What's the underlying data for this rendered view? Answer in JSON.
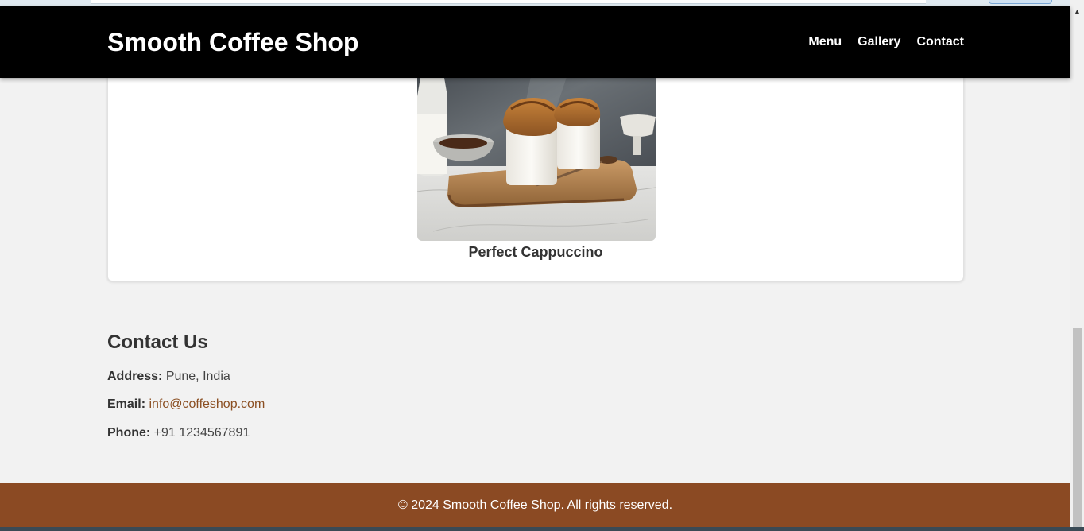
{
  "header": {
    "title": "Smooth Coffee Shop",
    "nav": [
      "Menu",
      "Gallery",
      "Contact"
    ]
  },
  "gallery": {
    "caption": "Perfect Cappuccino"
  },
  "contact": {
    "heading": "Contact Us",
    "address_label": "Address:",
    "address_value": "Pune, India",
    "email_label": "Email:",
    "email_value": "info@coffeshop.com",
    "phone_label": "Phone:",
    "phone_value": "+91 1234567891"
  },
  "footer": {
    "text": "© 2024 Smooth Coffee Shop. All rights reserved."
  },
  "colors": {
    "header_bg": "#000000",
    "footer_bg": "#8b4a23",
    "link": "#8b4f22",
    "page_bg": "#f2f2f2"
  }
}
